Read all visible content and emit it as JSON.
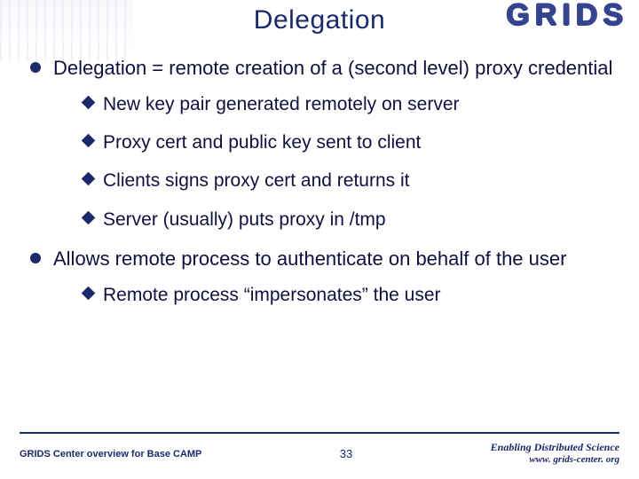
{
  "header": {
    "title": "Delegation",
    "logo": "GRIDS"
  },
  "bullets": [
    {
      "text": "Delegation = remote creation of a (second level) proxy credential",
      "sub": [
        "New key pair generated remotely on server",
        "Proxy cert and public key sent to client",
        "Clients signs proxy cert and returns it",
        "Server (usually) puts proxy in /tmp"
      ]
    },
    {
      "text": "Allows remote process to authenticate on behalf of the user",
      "sub": [
        "Remote process “impersonates” the user"
      ]
    }
  ],
  "footer": {
    "left": "GRIDS Center overview for Base CAMP",
    "page": "33",
    "right_line1": "Enabling Distributed Science",
    "right_line2": "www. grids-center. org"
  }
}
